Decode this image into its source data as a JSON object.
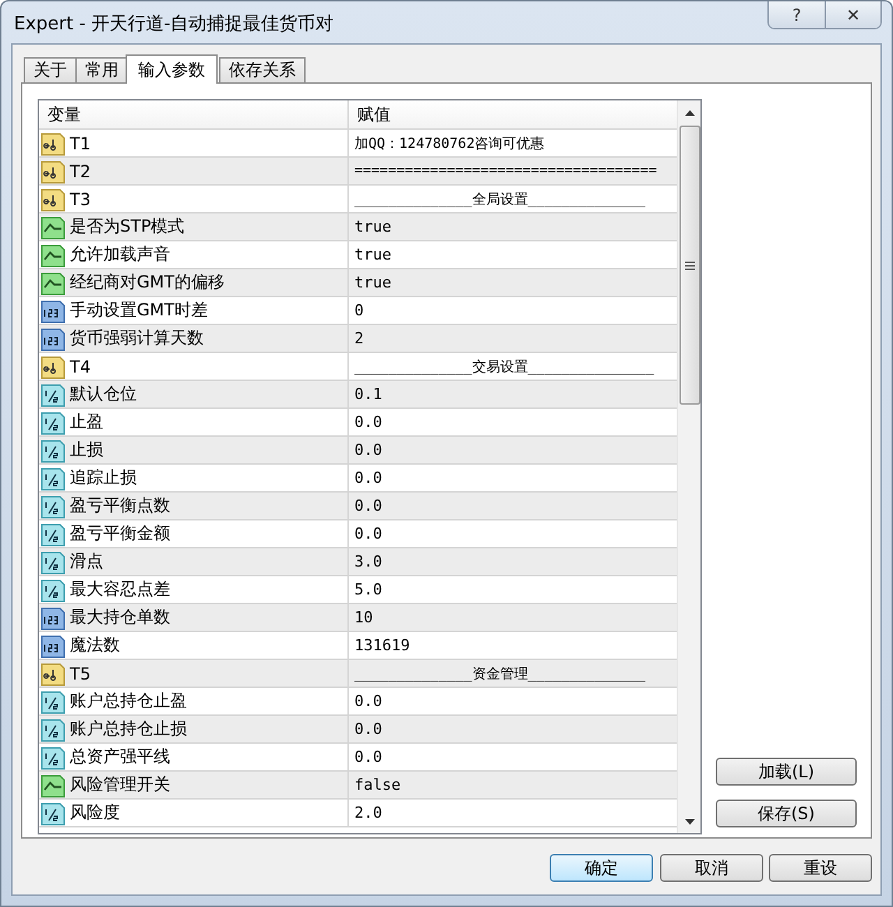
{
  "window": {
    "title": "Expert - 开天行道-自动捕捉最佳货币对",
    "help": "?",
    "close": "✕"
  },
  "tabs": [
    {
      "label": "关于",
      "selected": false
    },
    {
      "label": "常用",
      "selected": false
    },
    {
      "label": "输入参数",
      "selected": true
    },
    {
      "label": "依存关系",
      "selected": false
    }
  ],
  "table": {
    "columns": [
      "变量",
      "赋值"
    ],
    "rows": [
      {
        "kind": "string",
        "name": "T1",
        "value": "加QQ：124780762咨询可优惠"
      },
      {
        "kind": "string",
        "name": "T2",
        "value": "===================================="
      },
      {
        "kind": "string",
        "name": "T3",
        "value": "______________全局设置______________"
      },
      {
        "kind": "bool",
        "name": "是否为STP模式",
        "value": "true"
      },
      {
        "kind": "bool",
        "name": "允许加载声音",
        "value": "true"
      },
      {
        "kind": "bool",
        "name": "经纪商对GMT的偏移",
        "value": "true"
      },
      {
        "kind": "int",
        "name": "手动设置GMT时差",
        "value": "0"
      },
      {
        "kind": "int",
        "name": "货币强弱计算天数",
        "value": "2"
      },
      {
        "kind": "string",
        "name": "T4",
        "value": "______________交易设置_______________"
      },
      {
        "kind": "double",
        "name": "默认仓位",
        "value": "0.1"
      },
      {
        "kind": "double",
        "name": "止盈",
        "value": "0.0"
      },
      {
        "kind": "double",
        "name": "止损",
        "value": "0.0"
      },
      {
        "kind": "double",
        "name": "追踪止损",
        "value": "0.0"
      },
      {
        "kind": "double",
        "name": "盈亏平衡点数",
        "value": "0.0"
      },
      {
        "kind": "double",
        "name": "盈亏平衡金额",
        "value": "0.0"
      },
      {
        "kind": "double",
        "name": "滑点",
        "value": "3.0"
      },
      {
        "kind": "double",
        "name": "最大容忍点差",
        "value": "5.0"
      },
      {
        "kind": "int",
        "name": "最大持仓单数",
        "value": "10"
      },
      {
        "kind": "int",
        "name": "魔法数",
        "value": "131619"
      },
      {
        "kind": "string",
        "name": "T5",
        "value": "______________资金管理______________"
      },
      {
        "kind": "double",
        "name": "账户总持仓止盈",
        "value": "0.0"
      },
      {
        "kind": "double",
        "name": "账户总持仓止损",
        "value": "0.0"
      },
      {
        "kind": "double",
        "name": "总资产强平线",
        "value": "0.0"
      },
      {
        "kind": "bool",
        "name": "风险管理开关",
        "value": "false"
      },
      {
        "kind": "double",
        "name": "风险度",
        "value": "2.0"
      }
    ]
  },
  "side_buttons": [
    "加载(L)",
    "保存(S)"
  ],
  "buttons": [
    {
      "label": "确定",
      "default": true
    },
    {
      "label": "取消",
      "default": false
    },
    {
      "label": "重设",
      "default": false
    }
  ]
}
